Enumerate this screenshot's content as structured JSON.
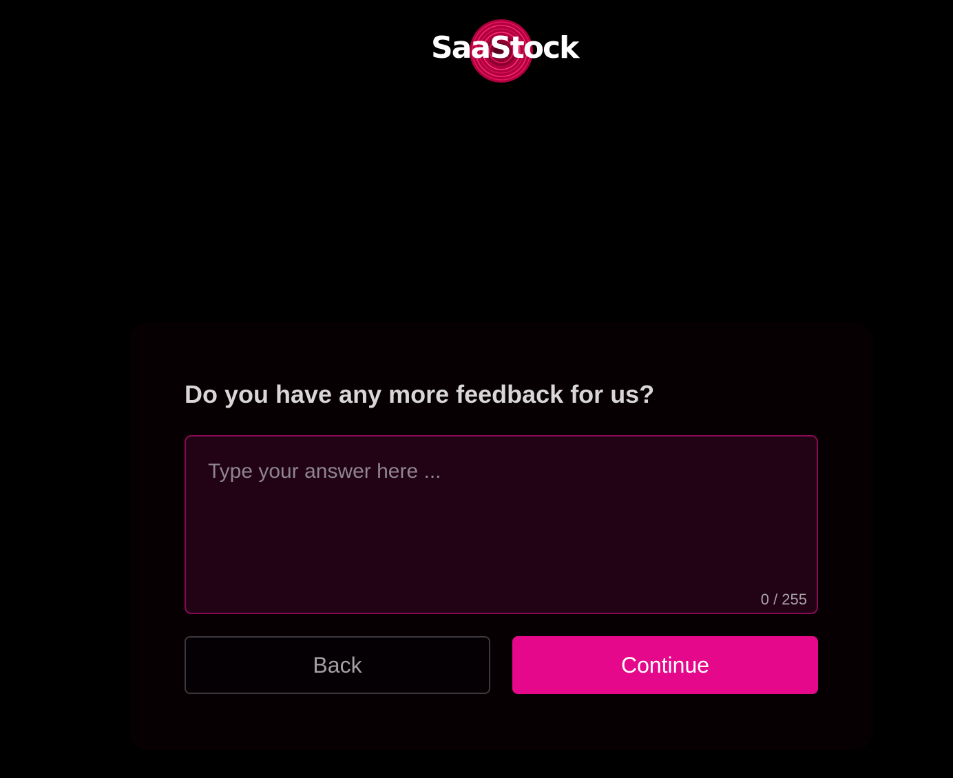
{
  "brand": {
    "logo_text": "SaaStock",
    "accent_color": "#e5088a"
  },
  "form": {
    "question": "Do you have any more feedback for us?",
    "answer": {
      "value": "",
      "placeholder": "Type your answer here ...",
      "counter": "0 / 255"
    },
    "back_label": "Back",
    "continue_label": "Continue"
  }
}
